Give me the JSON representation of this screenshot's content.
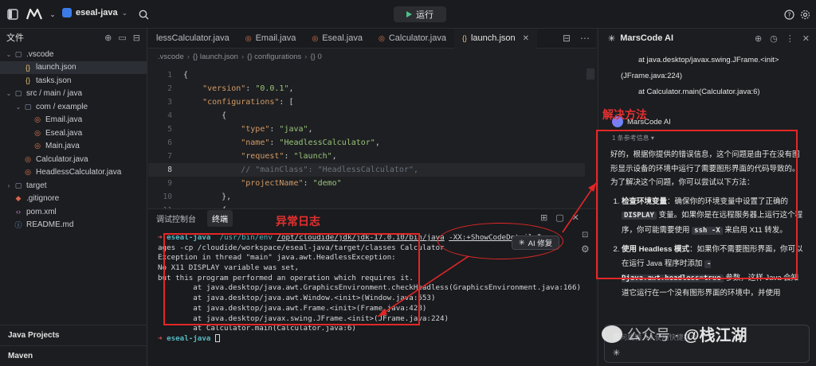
{
  "topbar": {
    "project_name": "eseal-java",
    "run_label": "运行"
  },
  "explorer": {
    "title": "文件",
    "items": [
      {
        "label": ".vscode",
        "type": "folder",
        "open": true,
        "level": 0
      },
      {
        "label": "launch.json",
        "type": "json",
        "level": 1,
        "selected": true
      },
      {
        "label": "tasks.json",
        "type": "json",
        "level": 1
      },
      {
        "label": "src / main / java",
        "type": "folder",
        "open": true,
        "level": 0
      },
      {
        "label": "com / example",
        "type": "folder",
        "open": true,
        "level": 1
      },
      {
        "label": "Email.java",
        "type": "java",
        "level": 2
      },
      {
        "label": "Eseal.java",
        "type": "java",
        "level": 2
      },
      {
        "label": "Main.java",
        "type": "java",
        "level": 2
      },
      {
        "label": "Calculator.java",
        "type": "java",
        "level": 1
      },
      {
        "label": "HeadlessCalculator.java",
        "type": "java",
        "level": 1
      },
      {
        "label": "target",
        "type": "folder",
        "open": false,
        "level": 0
      },
      {
        "label": ".gitignore",
        "type": "git",
        "level": 0
      },
      {
        "label": "pom.xml",
        "type": "xml",
        "level": 0
      },
      {
        "label": "README.md",
        "type": "md",
        "level": 0
      }
    ],
    "bottom_sections": [
      "Java Projects",
      "Maven"
    ]
  },
  "editor": {
    "tabs": [
      {
        "label": "lessCalculator.java",
        "type": "java"
      },
      {
        "label": "Email.java",
        "type": "java"
      },
      {
        "label": "Eseal.java",
        "type": "java"
      },
      {
        "label": "Calculator.java",
        "type": "java"
      },
      {
        "label": "launch.json",
        "type": "json",
        "active": true
      }
    ],
    "breadcrumb": [
      ".vscode",
      "{} launch.json",
      "{} configurations",
      "{} 0"
    ],
    "lines": [
      {
        "n": "1",
        "text": "{"
      },
      {
        "n": "2",
        "text": "    \"version\": \"0.0.1\","
      },
      {
        "n": "3",
        "text": "    \"configurations\": ["
      },
      {
        "n": "4",
        "text": "        {"
      },
      {
        "n": "5",
        "text": "            \"type\": \"java\","
      },
      {
        "n": "6",
        "text": "            \"name\": \"HeadlessCalculator\","
      },
      {
        "n": "7",
        "text": "            \"request\": \"launch\","
      },
      {
        "n": "8",
        "text": "            // \"mainClass\": \"HeadlessCalculator\",",
        "current": true
      },
      {
        "n": "9",
        "text": "            \"projectName\": \"demo\""
      },
      {
        "n": "10",
        "text": "        },"
      },
      {
        "n": "11",
        "text": "        {"
      }
    ]
  },
  "terminal": {
    "tabs": [
      "调试控制台",
      "终端"
    ],
    "prompt": "eseal-java",
    "cmd_path": "/usr/bin/env",
    "cmd_java": "/opt/cloudide/jdk/jdk-17.0.10/bin/java",
    "cmd_opts": "-XX:+ShowCodeDetailsIn",
    "line2": "ages -cp /cloudide/workspace/eseal-java/target/classes Calculator",
    "lines": [
      "Exception in thread \"main\" java.awt.HeadlessException:",
      "No X11 DISPLAY variable was set,",
      "but this program performed an operation which requires it.",
      "        at java.desktop/java.awt.GraphicsEnvironment.checkHeadless(GraphicsEnvironment.java:166)",
      "        at java.desktop/java.awt.Window.<init>(Window.java:553)",
      "        at java.desktop/java.awt.Frame.<init>(Frame.java:428)",
      "        at java.desktop/javax.swing.JFrame.<init>(JFrame.java:224)",
      "        at Calculator.main(Calculator.java:6)"
    ],
    "ai_fix_label": "AI 修复"
  },
  "annotations": {
    "error_log": "异常日志",
    "solution": "解决方法"
  },
  "ai_panel": {
    "title": "MarsCode AI",
    "stack_lines": [
      {
        "text": "at java.desktop/javax.swing.JFrame.<init>",
        "indent": true
      },
      {
        "text": "(JFrame.java:224)",
        "indent": false
      },
      {
        "text": "at Calculator.main(Calculator.java:6)",
        "indent": true
      }
    ],
    "responder": "MarsCode AI",
    "ref_info": "1 条参考信息",
    "intro": "好的，根据你提供的错误信息，这个问题是由于在没有图形显示设备的环境中运行了需要图形界面的代码导致的。为了解决这个问题，你可以尝试以下方法：",
    "item1_title": "检查环境变量",
    "item1_a": "：确保你的环境变量中设置了正确的",
    "item1_kw1": "DISPLAY",
    "item1_b": "变量。如果你是在远程服务器上运行这个程序，你可能需要使用",
    "item1_kw2": "ssh -X",
    "item1_c": "来启用 X11 转发。",
    "item2_title": "使用 Headless 模式",
    "item2_a": "：如果你不需要图形界面，你可以在运行 Java 程序时添加",
    "item2_kw": "-Djava.awt.headless=true",
    "item2_b": "参数，这样 Java 会知道它运行在一个没有图形界面的环境中，并使用",
    "input_placeholder": "提问或输入 / 使用快捷指令"
  },
  "watermark": {
    "prefix": "公众号 ·",
    "name": "@栈江湖"
  }
}
